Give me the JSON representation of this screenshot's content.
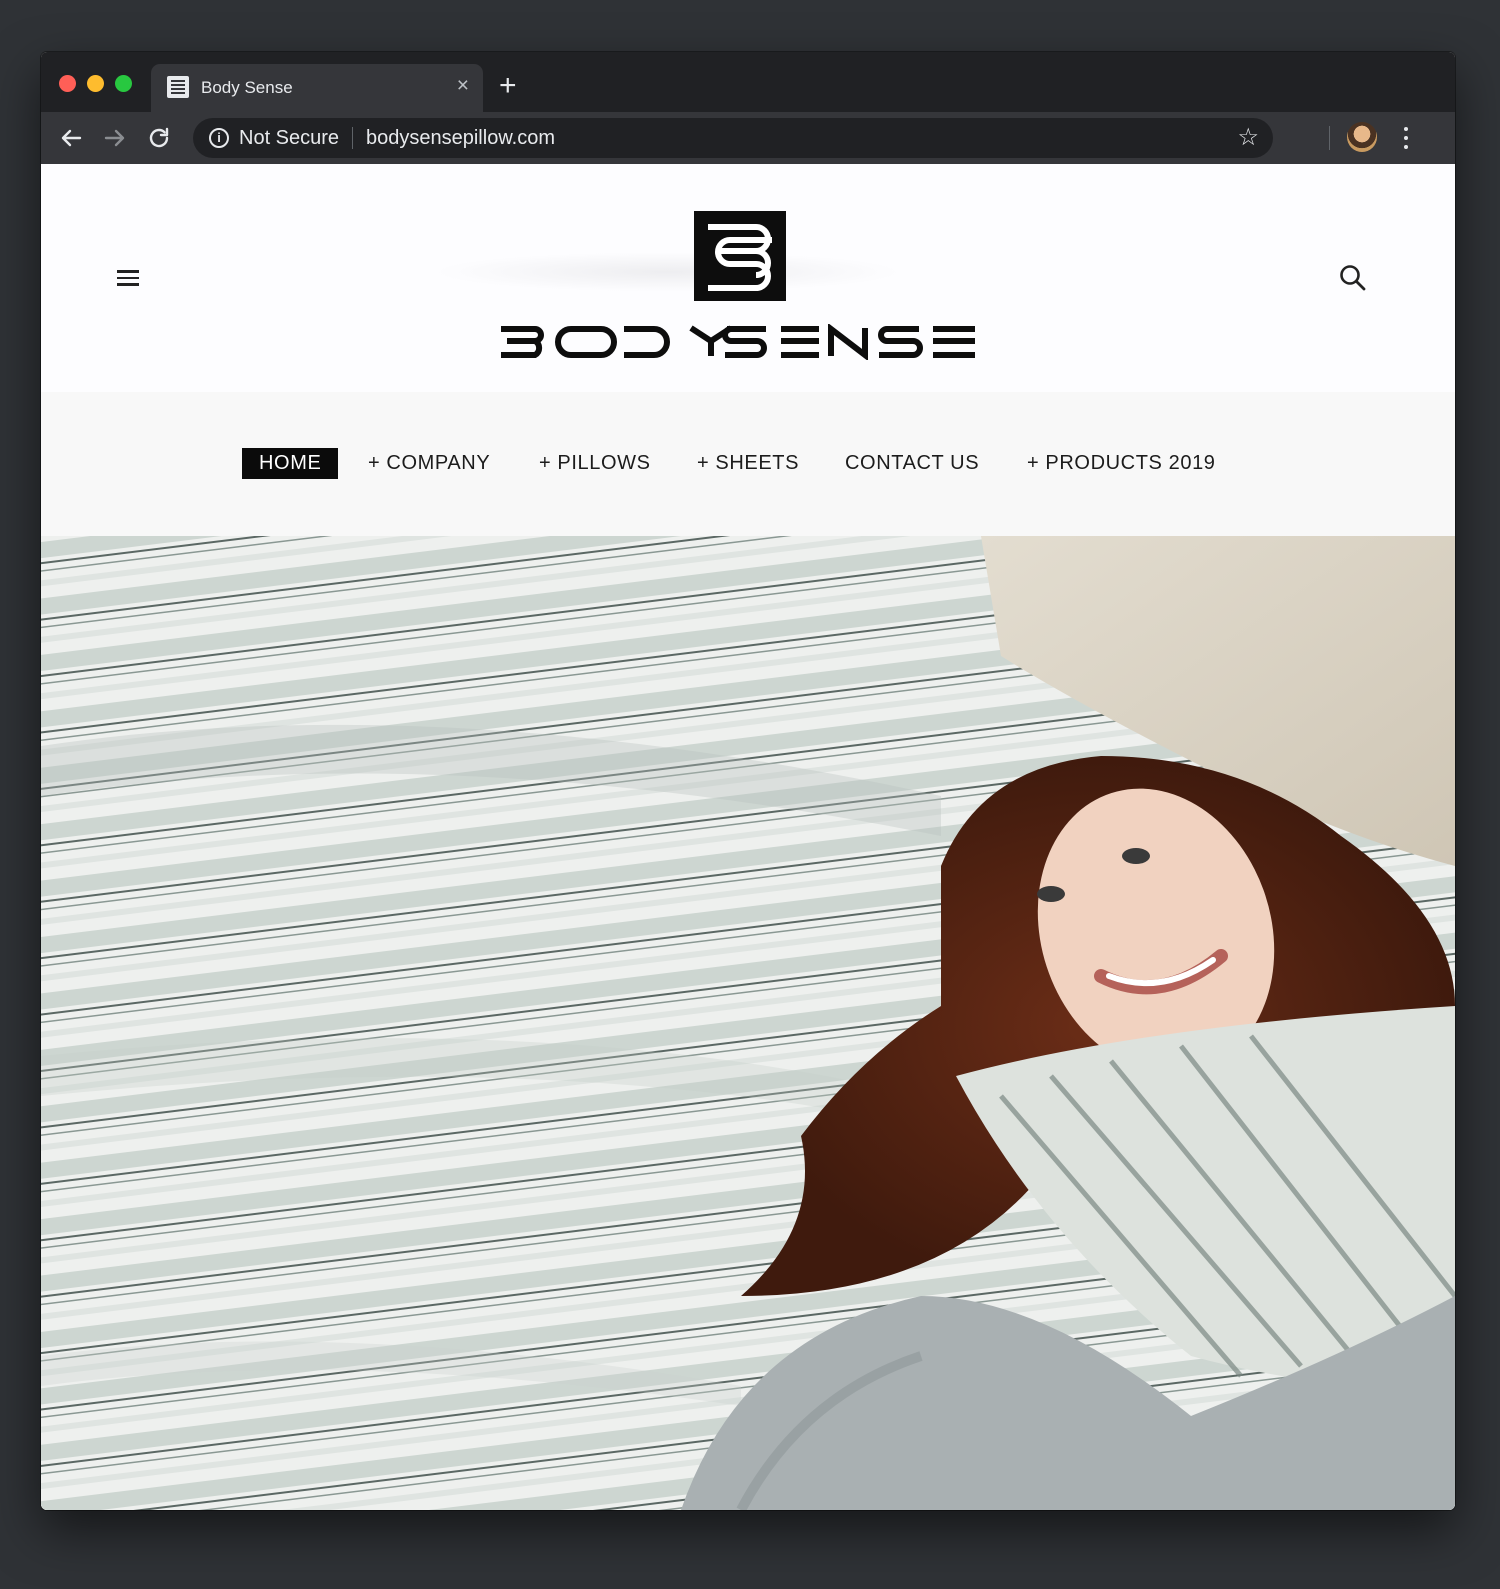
{
  "browser": {
    "tab_title": "Body Sense",
    "tab_close": "×",
    "new_tab": "+",
    "security_label": "Not Secure",
    "info_glyph": "i",
    "url": "bodysensepillow.com",
    "star_glyph": "☆"
  },
  "site": {
    "brand": "BODYSENSE",
    "nav": [
      {
        "label": "HOME",
        "active": true
      },
      {
        "label": "+ COMPANY"
      },
      {
        "label": "+ PILLOWS"
      },
      {
        "label": "+ SHEETS"
      },
      {
        "label": "CONTACT US"
      },
      {
        "label": "+ PRODUCTS 2019"
      }
    ]
  },
  "icons": {
    "hamburger": "menu-icon",
    "search": "search-icon",
    "back": "arrow-left-icon",
    "forward": "arrow-right-icon",
    "reload": "reload-icon",
    "info": "info-icon",
    "star": "star-icon",
    "menu": "kebab-menu-icon"
  },
  "colors": {
    "chrome_dark": "#202124",
    "chrome_tab": "#35363a",
    "nav_active_bg": "#0b0b0b",
    "nav_bg": "#f8f8f8"
  }
}
